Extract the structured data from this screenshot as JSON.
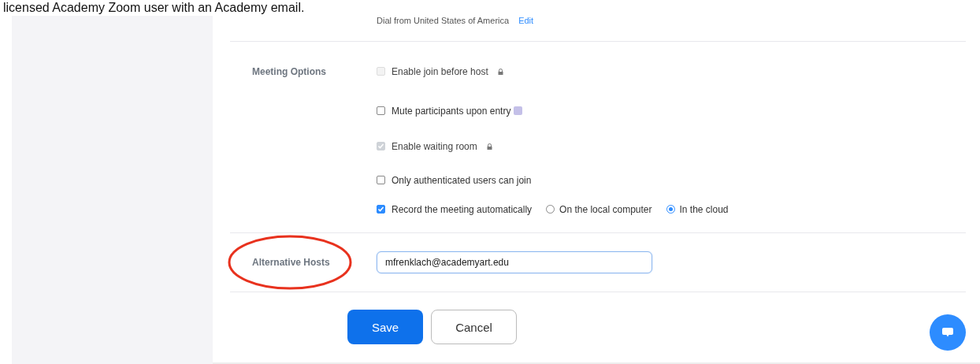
{
  "caption": "licensed Academy Zoom user with an Academy email.",
  "dial": {
    "text": "Dial from United States of America",
    "link": "Edit"
  },
  "meeting_options": {
    "label": "Meeting Options",
    "options": [
      {
        "label": "Enable join before host",
        "checked": false,
        "disabled": true,
        "locked": true,
        "info_badge": false
      },
      {
        "label": "Mute participants upon entry",
        "checked": false,
        "disabled": false,
        "locked": false,
        "info_badge": true
      },
      {
        "label": "Enable waiting room",
        "checked": true,
        "disabled": true,
        "locked": true,
        "info_badge": false
      },
      {
        "label": "Only authenticated users can join",
        "checked": false,
        "disabled": false,
        "locked": false,
        "info_badge": false
      },
      {
        "label": "Record the meeting automatically",
        "checked": true,
        "disabled": false,
        "locked": false,
        "info_badge": false,
        "radios": [
          {
            "label": "On the local computer",
            "selected": false
          },
          {
            "label": "In the cloud",
            "selected": true
          }
        ]
      }
    ]
  },
  "alternative_hosts": {
    "label": "Alternative Hosts",
    "value": "mfrenklach@academyart.edu",
    "circled": true
  },
  "buttons": [
    {
      "label": "Save",
      "kind": "primary"
    },
    {
      "label": "Cancel",
      "kind": "secondary"
    }
  ]
}
